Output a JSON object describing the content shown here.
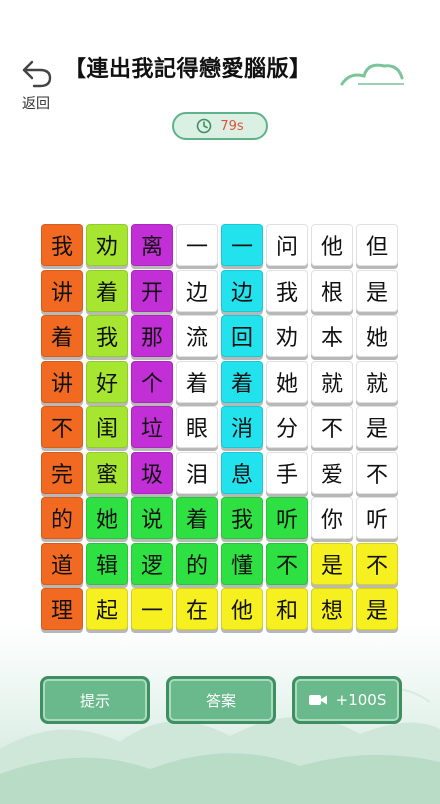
{
  "header": {
    "back_label": "返回",
    "title": "【連出我記得戀愛腦版】"
  },
  "timer": {
    "value": "79s",
    "icon": "clock-icon"
  },
  "board": {
    "rows": [
      [
        "我",
        "劝",
        "离",
        "一",
        "一",
        "问",
        "他",
        "但"
      ],
      [
        "讲",
        "着",
        "开",
        "边",
        "边",
        "我",
        "根",
        "是"
      ],
      [
        "着",
        "我",
        "那",
        "流",
        "回",
        "劝",
        "本",
        "她"
      ],
      [
        "讲",
        "好",
        "个",
        "着",
        "着",
        "她",
        "就",
        "就"
      ],
      [
        "不",
        "闺",
        "垃",
        "眼",
        "消",
        "分",
        "不",
        "是"
      ],
      [
        "完",
        "蜜",
        "圾",
        "泪",
        "息",
        "手",
        "爱",
        "不"
      ],
      [
        "的",
        "她",
        "说",
        "着",
        "我",
        "听",
        "你",
        "听"
      ],
      [
        "道",
        "辑",
        "逻",
        "的",
        "懂",
        "不",
        "是",
        "不"
      ],
      [
        "理",
        "起",
        "一",
        "在",
        "他",
        "和",
        "想",
        "是"
      ]
    ],
    "colors": [
      [
        "#f26a21",
        "#a6e631",
        "#c22fd6",
        "#ffffff",
        "#22e2ee",
        "#ffffff",
        "#ffffff",
        "#ffffff"
      ],
      [
        "#f26a21",
        "#a6e631",
        "#c22fd6",
        "#ffffff",
        "#22e2ee",
        "#ffffff",
        "#ffffff",
        "#ffffff"
      ],
      [
        "#f26a21",
        "#a6e631",
        "#c22fd6",
        "#ffffff",
        "#22e2ee",
        "#ffffff",
        "#ffffff",
        "#ffffff"
      ],
      [
        "#f26a21",
        "#a6e631",
        "#c22fd6",
        "#ffffff",
        "#22e2ee",
        "#ffffff",
        "#ffffff",
        "#ffffff"
      ],
      [
        "#f26a21",
        "#a6e631",
        "#c22fd6",
        "#ffffff",
        "#22e2ee",
        "#ffffff",
        "#ffffff",
        "#ffffff"
      ],
      [
        "#f26a21",
        "#a6e631",
        "#c22fd6",
        "#ffffff",
        "#22e2ee",
        "#ffffff",
        "#ffffff",
        "#ffffff"
      ],
      [
        "#f26a21",
        "#2fe042",
        "#2fe042",
        "#2fe042",
        "#2fe042",
        "#2fe042",
        "#ffffff",
        "#ffffff"
      ],
      [
        "#f26a21",
        "#2fe042",
        "#2fe042",
        "#2fe042",
        "#2fe042",
        "#2fe042",
        "#f6f020",
        "#f6f020"
      ],
      [
        "#f26a21",
        "#f6f020",
        "#f6f020",
        "#f6f020",
        "#f6f020",
        "#f6f020",
        "#f6f020",
        "#f6f020"
      ]
    ]
  },
  "actions": {
    "hint_label": "提示",
    "answer_label": "答案",
    "video_label": "+100S",
    "video_icon": "video-camera-icon"
  }
}
